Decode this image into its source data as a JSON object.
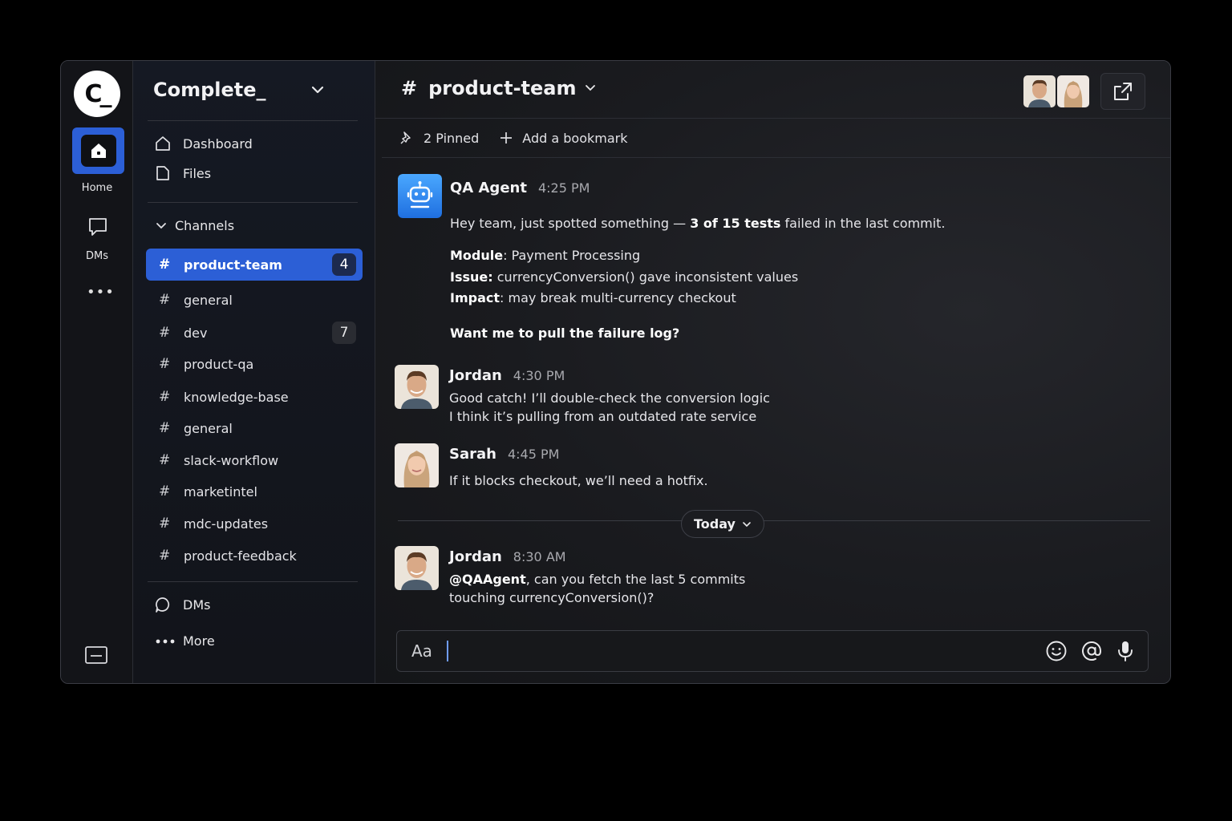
{
  "app": {
    "logo_text": "C_",
    "workspace": "Complete_"
  },
  "rail": {
    "home_label": "Home",
    "dms_label": "DMs",
    "more_label": "•••"
  },
  "sidebar": {
    "nav": [
      {
        "label": "Dashboard",
        "icon": "home-icon"
      },
      {
        "label": "Files",
        "icon": "file-icon"
      }
    ],
    "channels_label": "Channels",
    "channels": [
      {
        "name": "product-team",
        "badge": "4",
        "active": true
      },
      {
        "name": "general"
      },
      {
        "name": "dev",
        "badge": "7"
      },
      {
        "name": "product-qa"
      },
      {
        "name": "knowledge-base"
      },
      {
        "name": "general"
      },
      {
        "name": "slack-workflow"
      },
      {
        "name": "marketintel"
      },
      {
        "name": "mdc-updates"
      },
      {
        "name": "product-feedback"
      }
    ],
    "hash": "#",
    "dms_label": "DMs",
    "more_label": "More"
  },
  "channel": {
    "hash": "#",
    "title": "product-team",
    "pinned": "2 Pinned",
    "bookmark": "Add a bookmark"
  },
  "messages": {
    "m1": {
      "author": "QA Agent",
      "time": "4:25 PM",
      "line1_a": "Hey team, just spotted something — ",
      "line1_b": "3 of 15 tests",
      "line1_c": " failed in the last commit.",
      "module_label": "Module",
      "module_value": ": Payment Processing",
      "issue_label": "Issue:",
      "issue_value": " currencyConversion() gave inconsistent values",
      "impact_label": "Impact",
      "impact_value": ": may break multi-currency checkout",
      "question": "Want me to pull the failure log?"
    },
    "m2": {
      "author": "Jordan",
      "time": "4:30 PM",
      "line1": "Good catch! I’ll double-check the conversion logic",
      "line2": "I think it’s pulling from an outdated rate service"
    },
    "m3": {
      "author": "Sarah",
      "time": "4:45 PM",
      "line1": "If it blocks checkout, we’ll need a hotfix."
    },
    "divider": "Today",
    "m4": {
      "author": "Jordan",
      "time": "8:30 AM",
      "mention": "@QAAgent",
      "line1": ", can you fetch the last 5 commits",
      "line2": "touching currencyConversion()?"
    }
  },
  "composer": {
    "placeholder": "Aa"
  },
  "colors": {
    "accent": "#2c5fd6",
    "background": "#17181c"
  }
}
